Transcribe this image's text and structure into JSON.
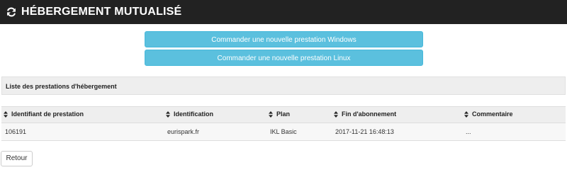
{
  "header": {
    "title": "HÉBERGEMENT MUTUALISÉ",
    "icon": "refresh-icon"
  },
  "actions": {
    "order_windows_label": "Commander une nouvelle prestation Windows",
    "order_linux_label": "Commander une nouvelle prestation Linux"
  },
  "panel": {
    "title": "Liste des prestations d'hébergement"
  },
  "table": {
    "columns": [
      "Identifiant de prestation",
      "Identification",
      "Plan",
      "Fin d'abonnement",
      "Commentaire"
    ],
    "rows": [
      {
        "id": "106191",
        "identification": "eurispark.fr",
        "plan": "IKL Basic",
        "end": "2017-11-21 16:48:13",
        "comment": "..."
      }
    ]
  },
  "footer": {
    "back_label": "Retour"
  },
  "colors": {
    "header_bg": "#222222",
    "button_info": "#5bc0de",
    "panel_bg": "#eeeeee"
  }
}
